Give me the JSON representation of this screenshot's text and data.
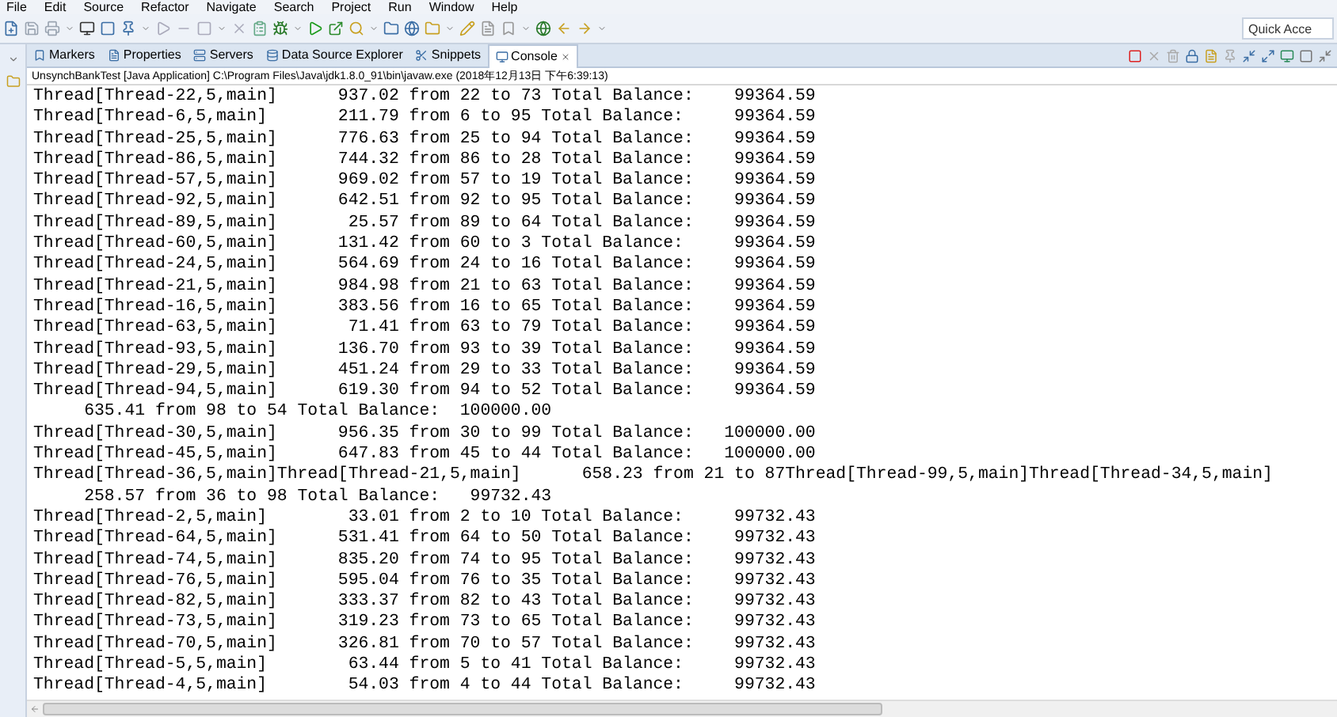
{
  "menu": [
    "File",
    "Edit",
    "Source",
    "Refactor",
    "Navigate",
    "Search",
    "Project",
    "Run",
    "Window",
    "Help"
  ],
  "quick_access": {
    "placeholder": "Quick Acce"
  },
  "view_tabs": [
    {
      "label": "Markers",
      "selected": false
    },
    {
      "label": "Properties",
      "selected": false
    },
    {
      "label": "Servers",
      "selected": false
    },
    {
      "label": "Data Source Explorer",
      "selected": false
    },
    {
      "label": "Snippets",
      "selected": false
    },
    {
      "label": "Console",
      "selected": true
    }
  ],
  "console": {
    "launch": "UnsynchBankTest [Java Application] C:\\Program Files\\Java\\jdk1.8.0_91\\bin\\javaw.exe (2018年12月13日 下午6:39:13)",
    "lines": [
      "Thread[Thread-22,5,main]      937.02 from 22 to 73 Total Balance:    99364.59",
      "Thread[Thread-6,5,main]       211.79 from 6 to 95 Total Balance:     99364.59",
      "Thread[Thread-25,5,main]      776.63 from 25 to 94 Total Balance:    99364.59",
      "Thread[Thread-86,5,main]      744.32 from 86 to 28 Total Balance:    99364.59",
      "Thread[Thread-57,5,main]      969.02 from 57 to 19 Total Balance:    99364.59",
      "Thread[Thread-92,5,main]      642.51 from 92 to 95 Total Balance:    99364.59",
      "Thread[Thread-89,5,main]       25.57 from 89 to 64 Total Balance:    99364.59",
      "Thread[Thread-60,5,main]      131.42 from 60 to 3 Total Balance:     99364.59",
      "Thread[Thread-24,5,main]      564.69 from 24 to 16 Total Balance:    99364.59",
      "Thread[Thread-21,5,main]      984.98 from 21 to 63 Total Balance:    99364.59",
      "Thread[Thread-16,5,main]      383.56 from 16 to 65 Total Balance:    99364.59",
      "Thread[Thread-63,5,main]       71.41 from 63 to 79 Total Balance:    99364.59",
      "Thread[Thread-93,5,main]      136.70 from 93 to 39 Total Balance:    99364.59",
      "Thread[Thread-29,5,main]      451.24 from 29 to 33 Total Balance:    99364.59",
      "Thread[Thread-94,5,main]      619.30 from 94 to 52 Total Balance:    99364.59",
      "     635.41 from 98 to 54 Total Balance:  100000.00",
      "Thread[Thread-30,5,main]      956.35 from 30 to 99 Total Balance:   100000.00",
      "Thread[Thread-45,5,main]      647.83 from 45 to 44 Total Balance:   100000.00",
      "Thread[Thread-36,5,main]Thread[Thread-21,5,main]      658.23 from 21 to 87Thread[Thread-99,5,main]Thread[Thread-34,5,main]",
      "     258.57 from 36 to 98 Total Balance:   99732.43",
      "Thread[Thread-2,5,main]        33.01 from 2 to 10 Total Balance:     99732.43",
      "Thread[Thread-64,5,main]      531.41 from 64 to 50 Total Balance:    99732.43",
      "Thread[Thread-74,5,main]      835.20 from 74 to 95 Total Balance:    99732.43",
      "Thread[Thread-76,5,main]      595.04 from 76 to 35 Total Balance:    99732.43",
      "Thread[Thread-82,5,main]      333.37 from 82 to 43 Total Balance:    99732.43",
      "Thread[Thread-73,5,main]      319.23 from 73 to 65 Total Balance:    99732.43",
      "Thread[Thread-70,5,main]      326.81 from 70 to 57 Total Balance:    99732.43",
      "Thread[Thread-5,5,main]        63.44 from 5 to 41 Total Balance:     99732.43",
      "Thread[Thread-4,5,main]        54.03 from 4 to 44 Total Balance:     99732.43"
    ]
  }
}
